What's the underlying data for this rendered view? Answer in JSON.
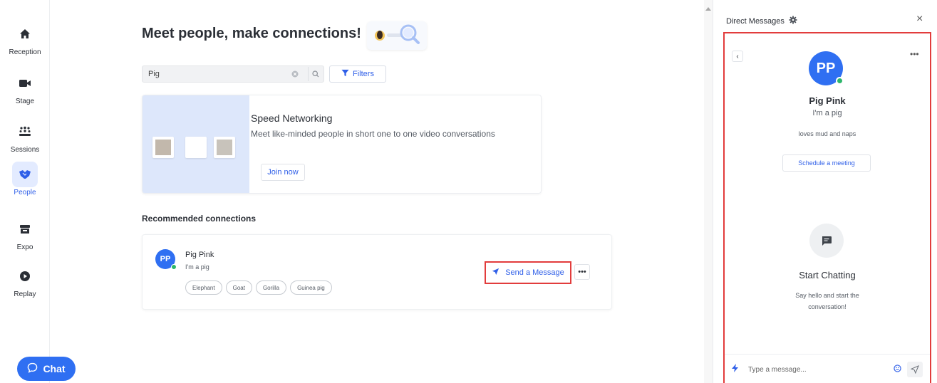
{
  "sidebar": {
    "items": [
      {
        "label": "Reception",
        "icon": "home-icon"
      },
      {
        "label": "Stage",
        "icon": "video-camera-icon"
      },
      {
        "label": "Sessions",
        "icon": "group-icon"
      },
      {
        "label": "People",
        "icon": "handshake-icon",
        "active": true
      },
      {
        "label": "Expo",
        "icon": "booth-icon"
      },
      {
        "label": "Replay",
        "icon": "play-icon"
      }
    ],
    "chat_label": "Chat"
  },
  "main": {
    "title": "Meet people, make connections!",
    "search": {
      "value": "Pig"
    },
    "filters_label": "Filters",
    "speed_networking": {
      "title": "Speed Networking",
      "description": "Meet like-minded people in short one to one video conversations",
      "join_label": "Join now"
    },
    "recommended": {
      "heading": "Recommended connections",
      "person": {
        "initials": "PP",
        "name": "Pig Pink",
        "tagline": "I'm a pig",
        "tags": [
          "Elephant",
          "Goat",
          "Gorilla",
          "Guinea pig"
        ],
        "send_label": "Send a Message",
        "more_label": "•••"
      }
    }
  },
  "dm": {
    "header": "Direct Messages",
    "close": "×",
    "back": "‹",
    "more": "•••",
    "initials": "PP",
    "name": "Pig Pink",
    "tagline": "I'm a pig",
    "bio": "loves mud and naps",
    "schedule_label": "Schedule a meeting",
    "start_title": "Start Chatting",
    "start_desc": "Say hello and start the conversation!",
    "input_placeholder": "Type a message..."
  },
  "colors": {
    "accent": "#2f6ff2",
    "highlight": "#e23c3c",
    "online": "#2db66b"
  }
}
